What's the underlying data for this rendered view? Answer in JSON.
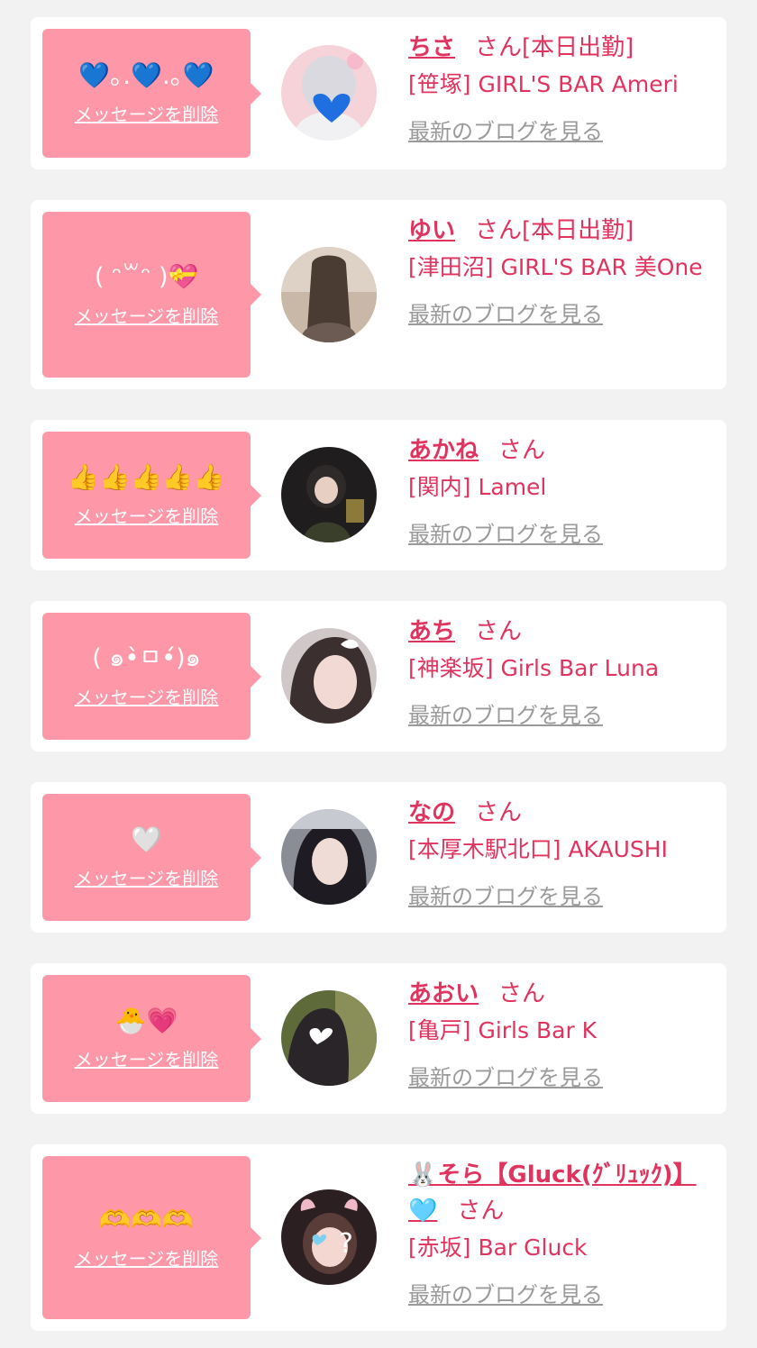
{
  "common": {
    "delete_label": "メッセージを削除",
    "blog_label": "最新のブログを見る",
    "honorific": "さん"
  },
  "colors": {
    "bubble": "#fe97a7",
    "accent": "#e0335e",
    "link_gray": "#9a9a9a",
    "background": "#f2f2f2"
  },
  "messages": [
    {
      "message": "💙｡.💙.｡💙",
      "name": "ちさ",
      "status": "[本日出勤]",
      "shop": "[笹塚] GIRL'S BAR Ameri"
    },
    {
      "message": "( ᵔ꒳ᵔ )💝",
      "name": "ゆい",
      "status": "[本日出勤]",
      "shop": "[津田沼] GIRL'S BAR 美One"
    },
    {
      "message": "👍👍👍👍👍",
      "name": "あかね",
      "status": "",
      "shop": "[関内] Lamel"
    },
    {
      "message": "( ๑•̀ㅁ•́)๑",
      "name": "あち",
      "status": "",
      "shop": "[神楽坂] Girls Bar Luna"
    },
    {
      "message": "🤍",
      "name": "なの",
      "status": "",
      "shop": "[本厚木駅北口] AKAUSHI"
    },
    {
      "message": "🐣💗",
      "name": "あおい",
      "status": "",
      "shop": "[亀戸] Girls Bar K"
    },
    {
      "message": "🫶🫶🫶",
      "name": "🐰そら【Gluck(ｸﾞﾘｭｯｸ)】🩵",
      "status": "",
      "shop": "[赤坂] Bar Gluck"
    }
  ]
}
